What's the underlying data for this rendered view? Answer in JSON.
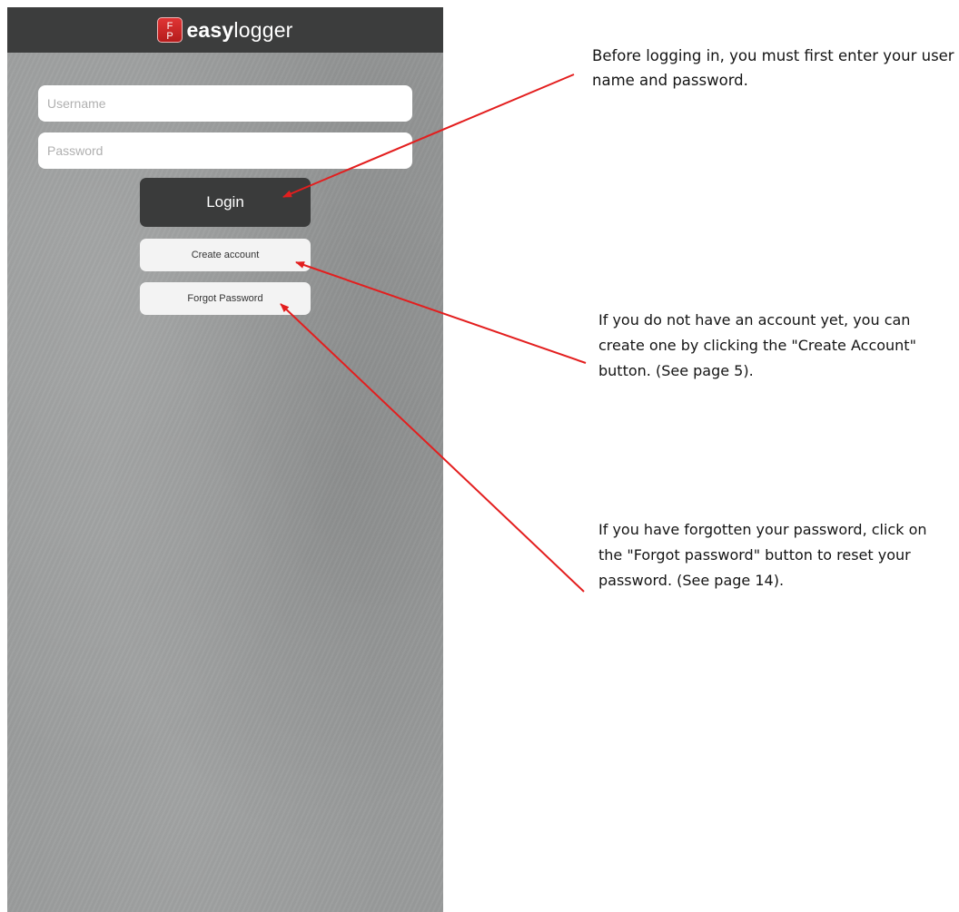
{
  "app": {
    "logo_mark": "F\nP",
    "logo_bold": "easy",
    "logo_light": "logger"
  },
  "login_form": {
    "username_placeholder": "Username",
    "password_placeholder": "Password",
    "login_label": "Login",
    "create_account_label": "Create account",
    "forgot_password_label": "Forgot Password"
  },
  "annotations": [
    {
      "text": "Before logging in, you must first enter your user name and password."
    },
    {
      "text": "If you do not have an account yet, you can create one by clicking the \"Create Account\" button. (See page 5)."
    },
    {
      "text": "If you have forgotten your password, click on the \"Forgot password\" button to reset your password. (See page 14)."
    }
  ],
  "colors": {
    "header_bg": "#3c3d3d",
    "login_button_bg": "#3a3b3b",
    "logo_red": "#d62828",
    "arrow_red": "#e31e1e"
  },
  "icons": [
    "app-logo-icon"
  ]
}
